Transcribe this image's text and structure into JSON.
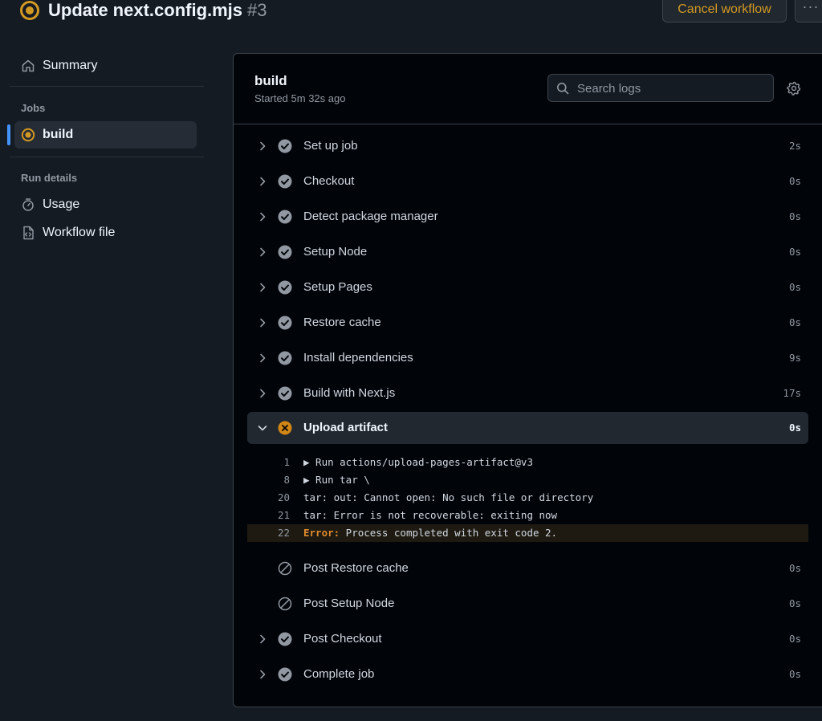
{
  "header": {
    "title": "Update next.config.mjs",
    "run_number": "#3",
    "cancel_label": "Cancel workflow",
    "more_label": "···",
    "status_color": "#d29922"
  },
  "sidebar": {
    "summary_label": "Summary",
    "jobs_heading": "Jobs",
    "job_label": "build",
    "run_details_heading": "Run details",
    "usage_label": "Usage",
    "workflow_file_label": "Workflow file"
  },
  "job": {
    "title": "build",
    "started": "Started 5m 32s ago",
    "search_placeholder": "Search logs"
  },
  "steps": [
    {
      "name": "Set up job",
      "duration": "2s",
      "status": "success"
    },
    {
      "name": "Checkout",
      "duration": "0s",
      "status": "success"
    },
    {
      "name": "Detect package manager",
      "duration": "0s",
      "status": "success"
    },
    {
      "name": "Setup Node",
      "duration": "0s",
      "status": "success"
    },
    {
      "name": "Setup Pages",
      "duration": "0s",
      "status": "success"
    },
    {
      "name": "Restore cache",
      "duration": "0s",
      "status": "success"
    },
    {
      "name": "Install dependencies",
      "duration": "9s",
      "status": "success"
    },
    {
      "name": "Build with Next.js",
      "duration": "17s",
      "status": "success"
    },
    {
      "name": "Upload artifact",
      "duration": "0s",
      "status": "failure"
    },
    {
      "name": "Post Restore cache",
      "duration": "0s",
      "status": "skipped"
    },
    {
      "name": "Post Setup Node",
      "duration": "0s",
      "status": "skipped"
    },
    {
      "name": "Post Checkout",
      "duration": "0s",
      "status": "success"
    },
    {
      "name": "Complete job",
      "duration": "0s",
      "status": "success"
    }
  ],
  "log": [
    {
      "line": "1",
      "text": "▶ Run actions/upload-pages-artifact@v3"
    },
    {
      "line": "8",
      "text": "▶ Run tar \\"
    },
    {
      "line": "20",
      "text": "tar: out: Cannot open: No such file or directory"
    },
    {
      "line": "21",
      "text": "tar: Error is not recoverable: exiting now"
    },
    {
      "line": "22",
      "error_keyword": "Error:",
      "text": " Process completed with exit code 2."
    }
  ]
}
